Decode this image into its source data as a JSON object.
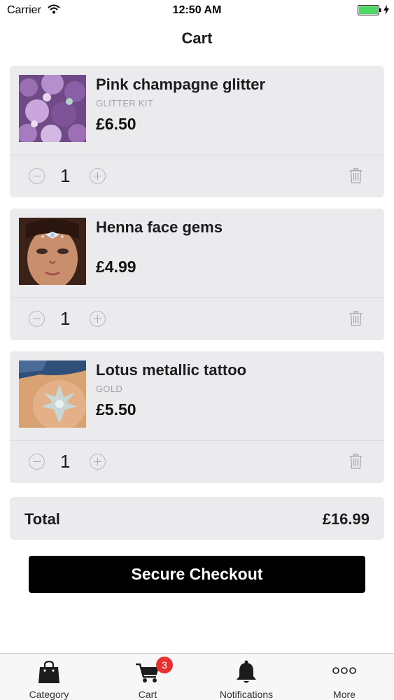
{
  "status_bar": {
    "carrier": "Carrier",
    "time": "12:50 AM"
  },
  "nav": {
    "title": "Cart"
  },
  "cart_items": [
    {
      "name": "Pink champagne glitter",
      "variant": "GLITTER KIT",
      "price": "£6.50",
      "quantity": "1"
    },
    {
      "name": "Henna face gems",
      "variant": "",
      "price": "£4.99",
      "quantity": "1"
    },
    {
      "name": "Lotus metallic tattoo",
      "variant": "GOLD",
      "price": "£5.50",
      "quantity": "1"
    }
  ],
  "summary": {
    "total_label": "Total",
    "total_value": "£16.99"
  },
  "checkout_label": "Secure Checkout",
  "tab_bar": {
    "items": [
      {
        "label": "Category",
        "icon": "shopping-bag-icon"
      },
      {
        "label": "Cart",
        "icon": "cart-icon",
        "badge": "3"
      },
      {
        "label": "Notifications",
        "icon": "bell-icon"
      },
      {
        "label": "More",
        "icon": "more-icon"
      }
    ]
  },
  "colors": {
    "card_bg": "#ebebee",
    "button_bg": "#000000",
    "badge": "#e8312f",
    "battery": "#4cd964"
  }
}
